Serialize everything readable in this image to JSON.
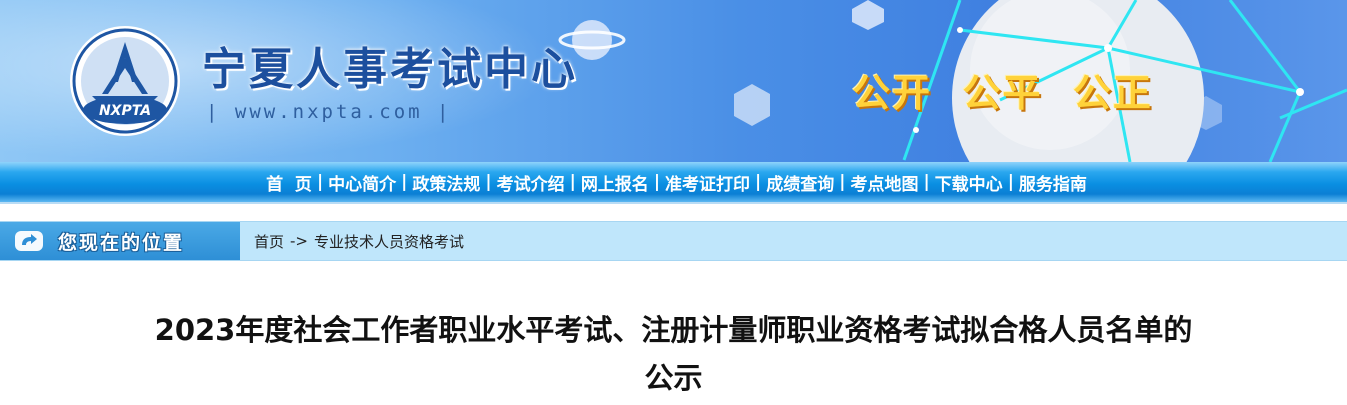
{
  "header": {
    "logo_text": "NXPTA",
    "site_title": "宁夏人事考试中心",
    "site_url": "| www.nxpta.com |",
    "slogan": "公开  公平  公正",
    "colors": {
      "title": "#1c4f9e",
      "slogan": "#ffd23a"
    }
  },
  "nav": {
    "items": [
      {
        "label": "首  页"
      },
      {
        "label": "中心简介"
      },
      {
        "label": "政策法规"
      },
      {
        "label": "考试介绍"
      },
      {
        "label": "网上报名"
      },
      {
        "label": "准考证打印"
      },
      {
        "label": "成绩查询"
      },
      {
        "label": "考点地图"
      },
      {
        "label": "下载中心"
      },
      {
        "label": "服务指南"
      }
    ],
    "separator": "|"
  },
  "breadcrumb": {
    "label": "您现在的位置",
    "home": "首页",
    "arrow": "->",
    "current": "专业技术人员资格考试"
  },
  "article": {
    "title": "2023年度社会工作者职业水平考试、注册计量师职业资格考试拟合格人员名单的公示"
  }
}
